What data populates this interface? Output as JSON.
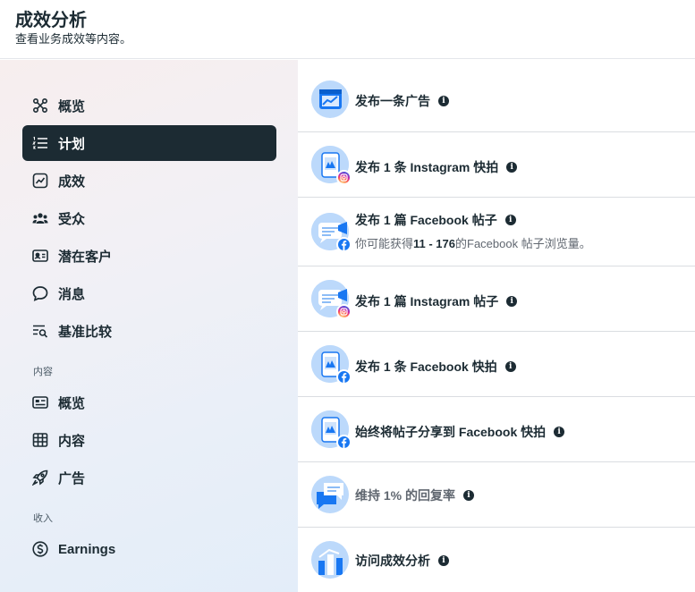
{
  "header": {
    "title": "成效分析",
    "subtitle": "查看业务成效等内容。"
  },
  "sidebar": {
    "items": [
      {
        "label": "概览",
        "icon": "overview-nodes-icon",
        "active": false
      },
      {
        "label": "计划",
        "icon": "plan-list-icon",
        "active": true
      },
      {
        "label": "成效",
        "icon": "performance-chart-icon",
        "active": false
      },
      {
        "label": "受众",
        "icon": "audience-people-icon",
        "active": false
      },
      {
        "label": "潜在客户",
        "icon": "leads-card-icon",
        "active": false
      },
      {
        "label": "消息",
        "icon": "messages-bubble-icon",
        "active": false
      },
      {
        "label": "基准比较",
        "icon": "benchmark-search-icon",
        "active": false
      }
    ],
    "content_section": {
      "label": "内容",
      "items": [
        {
          "label": "概览",
          "icon": "content-overview-icon"
        },
        {
          "label": "内容",
          "icon": "content-table-icon"
        },
        {
          "label": "广告",
          "icon": "ads-rocket-icon"
        }
      ]
    },
    "earnings_section": {
      "label": "收入",
      "items": [
        {
          "label": "Earnings",
          "icon": "dollar-circle-icon"
        }
      ]
    }
  },
  "tasks": [
    {
      "label": "发布一条广告",
      "badge": "ad-trend-icon",
      "sub": null
    },
    {
      "label": "发布 1 条 Instagram 快拍",
      "badge": "story-icon",
      "sub": "instagram-icon"
    },
    {
      "label": "发布 1 篇 Facebook 帖子",
      "badge": "post-icon",
      "sub": "facebook-icon",
      "desc_prefix": "你可能获得",
      "desc_bold": "11 - 176",
      "desc_suffix": "的Facebook 帖子浏览量。"
    },
    {
      "label": "发布 1 篇 Instagram 帖子",
      "badge": "post-icon",
      "sub": "instagram-icon"
    },
    {
      "label": "发布 1 条 Facebook 快拍",
      "badge": "story-icon",
      "sub": "facebook-icon"
    },
    {
      "label": "始终将帖子分享到 Facebook 快拍",
      "badge": "story-icon",
      "sub": "facebook-icon"
    },
    {
      "label": "维持 1% 的回复率",
      "badge": "reply-bubbles-icon",
      "sub": null,
      "muted": true
    },
    {
      "label": "访问成效分析",
      "badge": "insights-bars-icon",
      "sub": null
    }
  ],
  "colors": {
    "active_nav_bg": "#1c2b33",
    "badge_bg": "#bcd9fb",
    "facebook_blue": "#1877f2"
  }
}
